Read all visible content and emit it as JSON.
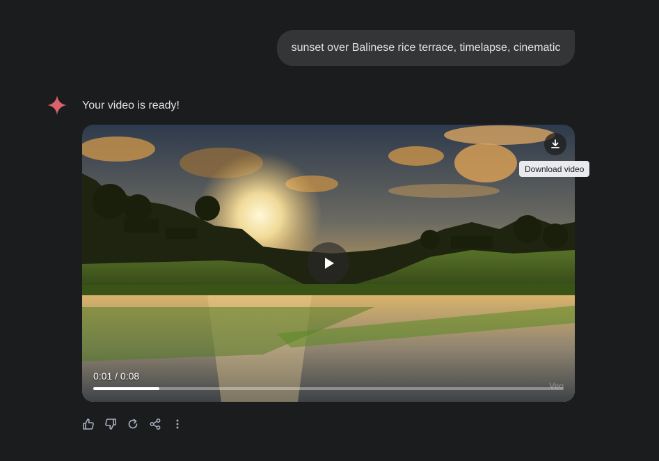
{
  "conversation": {
    "user_prompt": "sunset over Balinese rice terrace, timelapse, cinematic",
    "assistant_message": "Your video is ready!"
  },
  "video": {
    "current_time": "0:01",
    "duration": "0:08",
    "time_separator": " / ",
    "progress": 0.14,
    "watermark": "Veo",
    "download_tooltip": "Download video",
    "download_icon": "download-icon",
    "play_icon": "play-icon"
  },
  "actions": {
    "icons": [
      "thumbs-up-icon",
      "thumbs-down-icon",
      "regenerate-icon",
      "share-icon",
      "more-vert-icon"
    ]
  },
  "colors": {
    "background": "#1b1c1e",
    "bubble": "#333537",
    "gemini_spark": "#d9626b",
    "icon_gray": "#a8b0bd"
  }
}
